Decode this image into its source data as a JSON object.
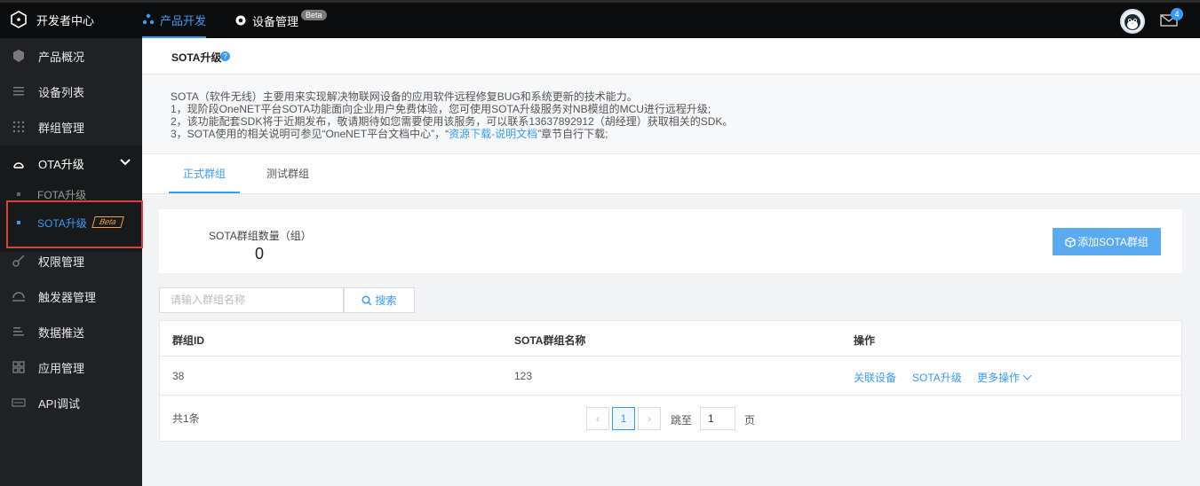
{
  "topbar": {
    "brand": "开发者中心",
    "nav": [
      {
        "label": "产品开发",
        "active": true
      },
      {
        "label": "设备管理",
        "badge": "Beta",
        "active": false
      }
    ],
    "mail_count": "4"
  },
  "sidebar": {
    "items": [
      {
        "label": "产品概况",
        "icon": "cube-icon"
      },
      {
        "label": "设备列表",
        "icon": "list-icon"
      },
      {
        "label": "群组管理",
        "icon": "grid-icon"
      },
      {
        "label": "OTA升级",
        "icon": "ota-icon"
      },
      {
        "label": "权限管理",
        "icon": "key-icon"
      },
      {
        "label": "触发器管理",
        "icon": "trigger-icon"
      },
      {
        "label": "数据推送",
        "icon": "push-icon"
      },
      {
        "label": "应用管理",
        "icon": "apps-icon"
      },
      {
        "label": "API调试",
        "icon": "api-icon"
      }
    ],
    "ota_sub": [
      {
        "label": "FOTA升级",
        "active": false
      },
      {
        "label": "SOTA升级",
        "active": true,
        "badge": "Beta"
      }
    ]
  },
  "page": {
    "title": "SOTA升级",
    "help": "?"
  },
  "description": {
    "line0": "SOTA（软件无线）主要用来实现解决物联网设备的应用软件远程修复BUG和系统更新的技术能力。",
    "line1": "1，现阶段OneNET平台SOTA功能面向企业用户免费体验，您可使用SOTA升级服务对NB模组的MCU进行远程升级;",
    "line2": "2，该功能配套SDK将于近期发布，敬请期待如您需要使用该服务，可以联系13637892912（胡经理）获取相关的SDK。",
    "line3_prefix": "3，SOTA使用的相关说明可参见“OneNET平台文档中心”，“",
    "line3_link": "资源下载-说明文档",
    "line3_suffix": "”章节自行下载;"
  },
  "tabs": [
    {
      "label": "正式群组",
      "active": true
    },
    {
      "label": "测试群组",
      "active": false
    }
  ],
  "summary": {
    "label": "SOTA群组数量（组）",
    "count": "0",
    "add_button": "添加SOTA群组"
  },
  "search": {
    "placeholder": "请输入群组名称",
    "button": "搜索"
  },
  "table": {
    "headers": [
      "群组ID",
      "SOTA群组名称",
      "操作"
    ],
    "rows": [
      {
        "id": "38",
        "name": "123",
        "actions": [
          "关联设备",
          "SOTA升级",
          "更多操作"
        ]
      }
    ],
    "total": "共1条"
  },
  "pagination": {
    "prev": "‹",
    "current": "1",
    "next": "›",
    "jump_label": "跳至",
    "jump_value": "1",
    "page_label": "页"
  },
  "colors": {
    "accent": "#3a9bf0",
    "sidebar_bg": "#1f2124",
    "topbar_bg": "#0b0c0e",
    "highlight_border": "#e33c3c",
    "beta_orange": "#f0a050"
  }
}
